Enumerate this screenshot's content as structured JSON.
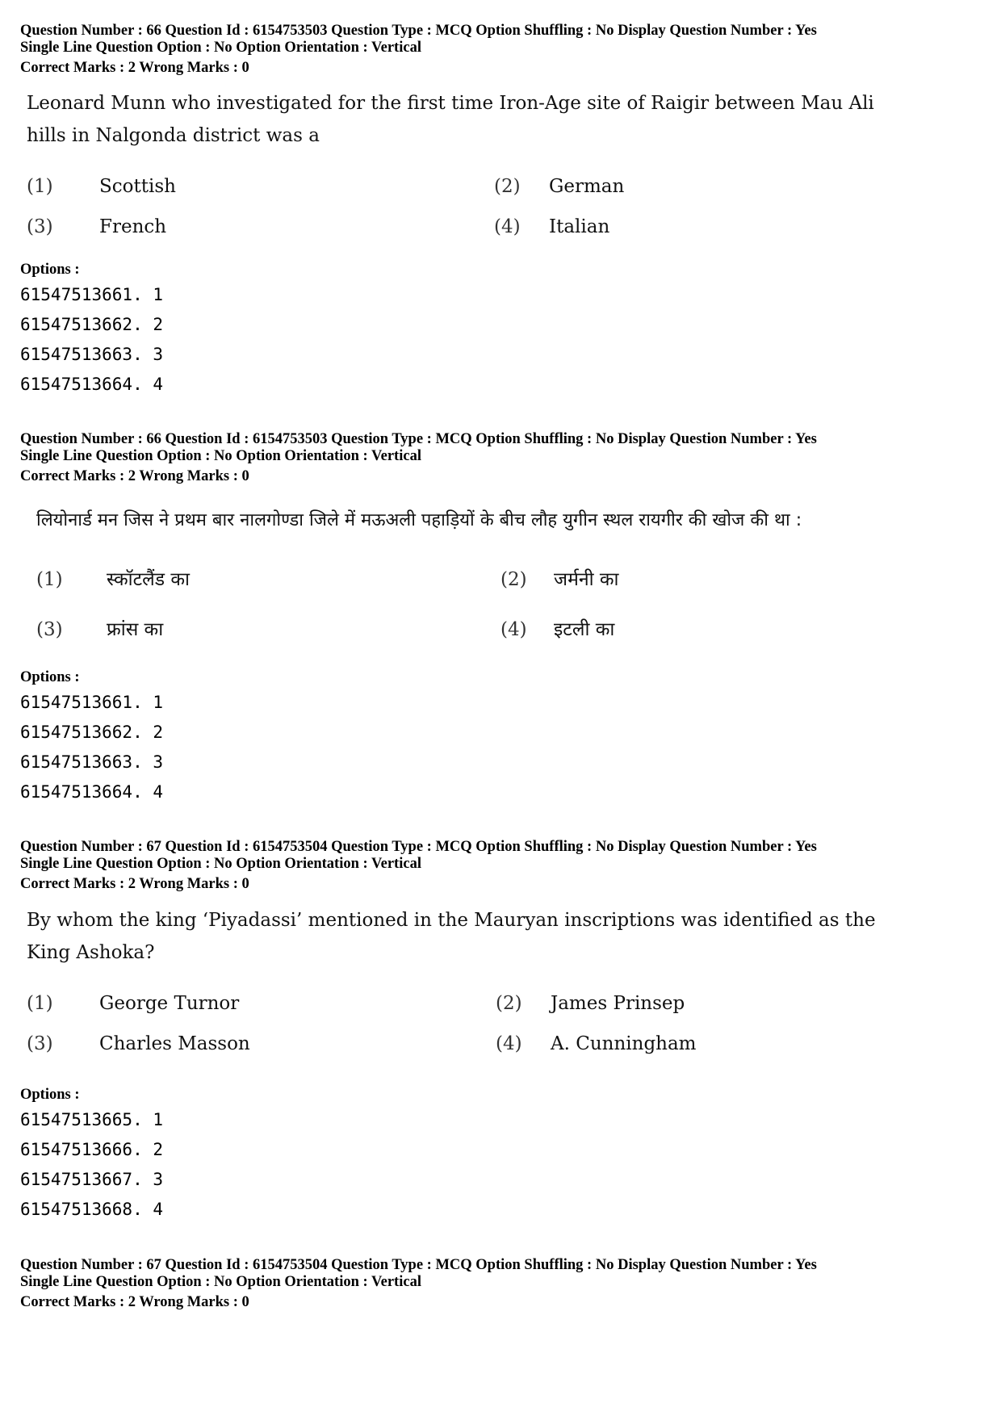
{
  "blocks": [
    {
      "meta_line1": "Question Number : 66  Question Id : 6154753503  Question Type : MCQ  Option Shuffling : No  Display Question Number : Yes",
      "meta_line2": "Single Line Question Option : No  Option Orientation : Vertical",
      "marks": "Correct Marks : 2  Wrong Marks : 0",
      "question_line1": "Leonard Munn who investigated for the first time Iron-Age site of Raigir between Mau Ali",
      "question_line2": "hills in Nalgonda district was a",
      "options": [
        {
          "num": "(1)",
          "text": "Scottish"
        },
        {
          "num": "(2)",
          "text": "German"
        },
        {
          "num": "(3)",
          "text": "French"
        },
        {
          "num": "(4)",
          "text": "Italian"
        }
      ],
      "options_label": "Options :",
      "option_ids": [
        "61547513661. 1",
        "61547513662. 2",
        "61547513663. 3",
        "61547513664. 4"
      ]
    },
    {
      "meta_line1": "Question Number : 66  Question Id : 6154753503  Question Type : MCQ  Option Shuffling : No  Display Question Number : Yes",
      "meta_line2": "Single Line Question Option : No  Option Orientation : Vertical",
      "marks": "Correct Marks : 2  Wrong Marks : 0",
      "question_line1": "लियोनार्ड मन जिस ने प्रथम बार नालगोण्डा जिले में मऊअली पहाड़ियों के बीच लौह युगीन स्थल रायगीर की खोज की था :",
      "options": [
        {
          "num": "(1)",
          "text": "स्कॉटलैंड का"
        },
        {
          "num": "(2)",
          "text": "जर्मनी का"
        },
        {
          "num": "(3)",
          "text": "फ्रांस का"
        },
        {
          "num": "(4)",
          "text": "इटली का"
        }
      ],
      "options_label": "Options :",
      "option_ids": [
        "61547513661. 1",
        "61547513662. 2",
        "61547513663. 3",
        "61547513664. 4"
      ]
    },
    {
      "meta_line1": "Question Number : 67  Question Id : 6154753504  Question Type : MCQ  Option Shuffling : No  Display Question Number : Yes",
      "meta_line2": "Single Line Question Option : No  Option Orientation : Vertical",
      "marks": "Correct Marks : 2  Wrong Marks : 0",
      "question_line1": "By whom the king ‘Piyadassi’ mentioned in the Mauryan inscriptions was identified as the",
      "question_line2": "King Ashoka?",
      "options": [
        {
          "num": "(1)",
          "text": "George Turnor"
        },
        {
          "num": "(2)",
          "text": "James Prinsep"
        },
        {
          "num": "(3)",
          "text": "Charles Masson"
        },
        {
          "num": "(4)",
          "text": "A. Cunningham"
        }
      ],
      "options_label": "Options :",
      "option_ids": [
        "61547513665. 1",
        "61547513666. 2",
        "61547513667. 3",
        "61547513668. 4"
      ]
    },
    {
      "meta_line1": "Question Number : 67  Question Id : 6154753504  Question Type : MCQ  Option Shuffling : No  Display Question Number : Yes",
      "meta_line2": "Single Line Question Option : No  Option Orientation : Vertical",
      "marks": "Correct Marks : 2  Wrong Marks : 0"
    }
  ]
}
